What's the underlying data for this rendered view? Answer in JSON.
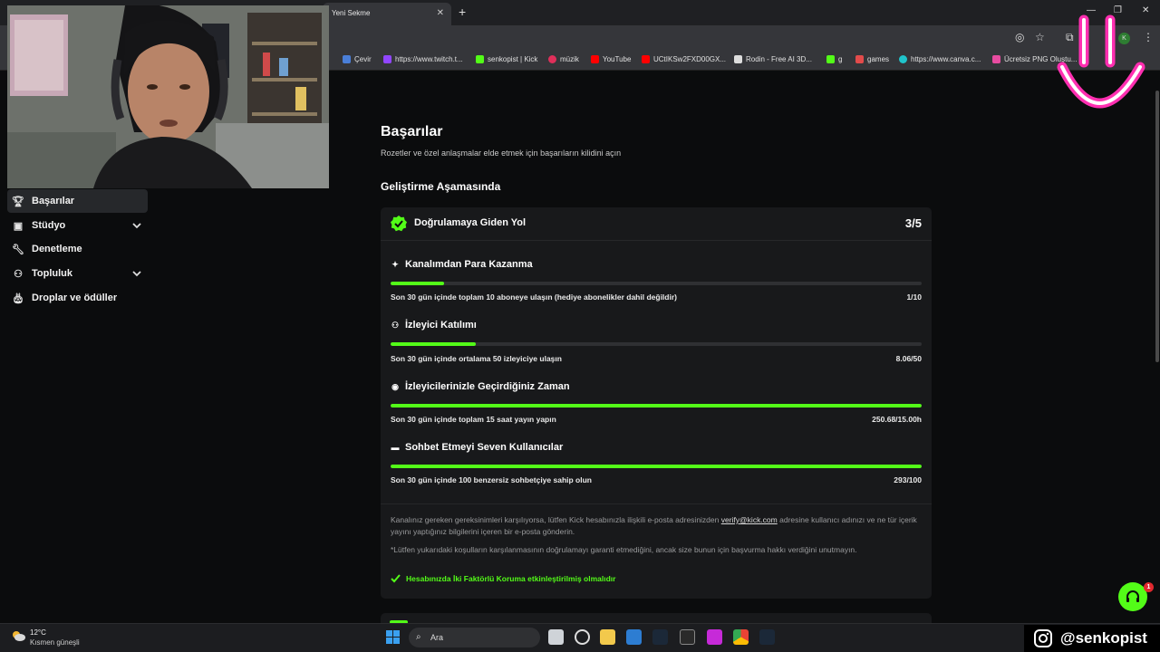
{
  "browser": {
    "tab_title": "Yeni Sekme",
    "bookmarks": [
      {
        "label": "Çevir",
        "color": "#4a7fd8"
      },
      {
        "label": "https://www.twitch.t...",
        "color": "#9146ff"
      },
      {
        "label": "senkopist | Kick",
        "color": "#53fc18"
      },
      {
        "label": "müzik",
        "color": "#e02f5a"
      },
      {
        "label": "YouTube",
        "color": "#ff0000"
      },
      {
        "label": "UCtIKSw2FXD00GX...",
        "color": "#ff0000"
      },
      {
        "label": "Rodin - Free AI 3D...",
        "color": "#dddddd"
      },
      {
        "label": "g",
        "color": "#53fc18"
      },
      {
        "label": "games",
        "color": "#e24b4b"
      },
      {
        "label": "https://www.canva.c...",
        "color": "#20c4cb"
      },
      {
        "label": "Ücretsiz PNG Oluştu...",
        "color": "#e74ca0"
      }
    ]
  },
  "sidebar": {
    "items": [
      {
        "label": "Başarılar",
        "icon": "trophy-icon"
      },
      {
        "label": "Stüdyo",
        "icon": "studio-icon"
      },
      {
        "label": "Denetleme",
        "icon": "wrench-icon"
      },
      {
        "label": "Topluluk",
        "icon": "community-icon"
      },
      {
        "label": "Droplar ve ödüller",
        "icon": "cake-icon"
      }
    ]
  },
  "main": {
    "title": "Başarılar",
    "subtitle": "Rozetler ve özel anlaşmalar elde etmek için başarıların kilidini açın",
    "section": "Geliştirme Aşamasında",
    "card": {
      "title": "Doğrulamaya Giden Yol",
      "count": "3/5",
      "requirements": [
        {
          "title": "Kanalımdan Para Kazanma",
          "icon": "sparkle-icon",
          "desc": "Son 30 gün içinde toplam 10 aboneye ulaşın (hediye abonelikler dahil değildir)",
          "value": "1/10",
          "progress": 0.1
        },
        {
          "title": "İzleyici Katılımı",
          "icon": "viewers-icon",
          "desc": "Son 30 gün içinde ortalama 50 izleyiciye ulaşın",
          "value": "8.06/50",
          "progress": 0.1612
        },
        {
          "title": "İzleyicilerinizle Geçirdiğiniz Zaman",
          "icon": "broadcast-icon",
          "desc": "Son 30 gün içinde toplam 15 saat yayın yapın",
          "value": "250.68/15.00h",
          "progress": 1.0
        },
        {
          "title": "Sohbet Etmeyi Seven Kullanıcılar",
          "icon": "chat-icon",
          "desc": "Son 30 gün içinde 100 benzersiz sohbetçiye sahip olun",
          "value": "293/100",
          "progress": 1.0
        }
      ],
      "note1_pre": "Kanalınız gereken gereksinimleri karşılıyorsa, lütfen Kick hesabınızla ilişkili e-posta adresinizden",
      "note1_link": "verify@kick.com",
      "note1_post": "adresine kullanıcı adınızı ve ne tür içerik yayını yaptığınız bilgilerini içeren bir e-posta gönderin.",
      "note2": "*Lütfen yukarıdaki koşulların karşılanmasının doğrulamayı garanti etmediğini, ancak size bunun için başvurma hakkı verdiğini unutmayın.",
      "twofa": "Hesabınızda İki Faktörlü Koruma etkinleştirilmiş olmalıdır"
    }
  },
  "help_badge": "1",
  "taskbar": {
    "temperature": "12°C",
    "weather": "Kısmen güneşli",
    "search_placeholder": "Ara"
  },
  "overlay": {
    "instagram": "@senkopist"
  },
  "colors": {
    "accent": "#53fc18",
    "card": "#18191b",
    "background": "#0b0c0d"
  }
}
